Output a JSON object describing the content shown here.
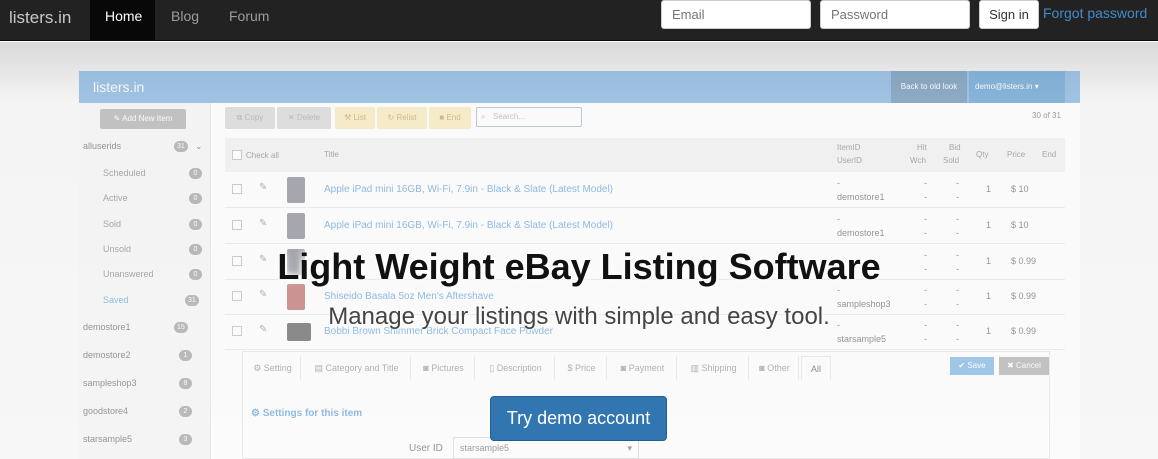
{
  "nav": {
    "brand": "listers.in",
    "links": [
      {
        "label": "Home"
      },
      {
        "label": "Blog"
      },
      {
        "label": "Forum"
      }
    ],
    "email_placeholder": "Email",
    "password_placeholder": "Password",
    "signin_label": "Sign in",
    "forgot_label": "Forgot password"
  },
  "app": {
    "title": "listers.in",
    "back_to_old_look": "Back to old look",
    "user": "demo@listers.in",
    "add_item": "Add New Item",
    "sidebar": [
      {
        "label": "alluserids",
        "count": "31"
      },
      {
        "label": "Scheduled",
        "count": "0"
      },
      {
        "label": "Active",
        "count": "0"
      },
      {
        "label": "Sold",
        "count": "0"
      },
      {
        "label": "Unsold",
        "count": "0"
      },
      {
        "label": "Unanswered",
        "count": "0"
      },
      {
        "label": "Saved",
        "count": "31"
      },
      {
        "label": "demostore1",
        "count": "15"
      },
      {
        "label": "demostore2",
        "count": "1"
      },
      {
        "label": "sampleshop3",
        "count": "8"
      },
      {
        "label": "goodstore4",
        "count": "2"
      },
      {
        "label": "starsample5",
        "count": "3"
      }
    ],
    "toolbar": {
      "copy": "Copy",
      "delete": "Delete",
      "list": "List",
      "relist": "Relist",
      "end": "End",
      "search_placeholder": "Search...",
      "page_count": "30 of 31"
    },
    "table_headers": {
      "check_all": "Check all",
      "title": "Title",
      "itemid": "ItemID",
      "userid": "UserID",
      "hit": "Hit",
      "wch": "Wch",
      "bid": "Bid",
      "sold": "Sold",
      "qty": "Qty",
      "price": "Price",
      "end": "End"
    },
    "rows": [
      {
        "title": "Apple iPad mini 16GB, Wi-Fi, 7.9in - Black & Slate (Latest Model)",
        "itemid": "-",
        "userid": "demostore1",
        "hit": "-",
        "wch": "-",
        "bid": "-",
        "sold": "-",
        "qty": "1",
        "price": "$ 10"
      },
      {
        "title": "Apple iPad mini 16GB, Wi-Fi, 7.9in - Black & Slate (Latest Model)",
        "itemid": "-",
        "userid": "demostore1",
        "hit": "-",
        "wch": "-",
        "bid": "-",
        "sold": "-",
        "qty": "1",
        "price": "$ 10"
      },
      {
        "title": "",
        "itemid": "",
        "userid": "",
        "hit": "-",
        "wch": "-",
        "bid": "-",
        "sold": "-",
        "qty": "1",
        "price": "$ 0.99"
      },
      {
        "title": "Shiseido Basala 5oz Men's Aftershave",
        "itemid": "-",
        "userid": "sampleshop3",
        "hit": "-",
        "wch": "-",
        "bid": "-",
        "sold": "-",
        "qty": "1",
        "price": "$ 0.99"
      },
      {
        "title": "Bobbi Brown Shimmer Brick Compact Face Powder",
        "itemid": "-",
        "userid": "starsample5",
        "hit": "-",
        "wch": "-",
        "bid": "-",
        "sold": "-",
        "qty": "1",
        "price": "$ 0.99"
      }
    ],
    "detail_tabs": [
      "Setting",
      "Category and Title",
      "Pictures",
      "Description",
      "Price",
      "Payment",
      "Shipping",
      "Other",
      "All"
    ],
    "save": "Save",
    "cancel": "Cancel",
    "settings_heading": "Settings for this item",
    "userid_label": "User ID",
    "userid_value": "starsample5"
  },
  "hero": {
    "headline": "Light Weight eBay Listing Software",
    "subheadline": "Manage your listings with simple and easy tool.",
    "cta": "Try demo account"
  }
}
